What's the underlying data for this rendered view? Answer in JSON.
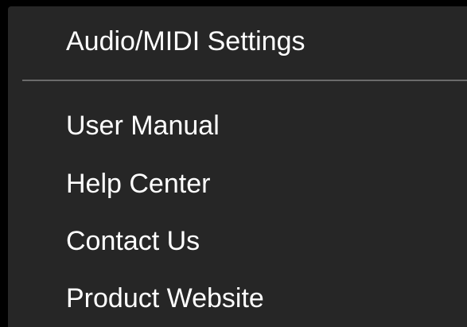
{
  "menu": {
    "top_items": [
      {
        "label": "Audio/MIDI Settings"
      }
    ],
    "bottom_items": [
      {
        "label": "User Manual"
      },
      {
        "label": "Help Center"
      },
      {
        "label": "Contact Us"
      },
      {
        "label": "Product Website"
      }
    ]
  },
  "colors": {
    "backdrop": "#000000",
    "panel": "#262626",
    "text": "#ffffff",
    "separator": "#6a6a6a"
  }
}
